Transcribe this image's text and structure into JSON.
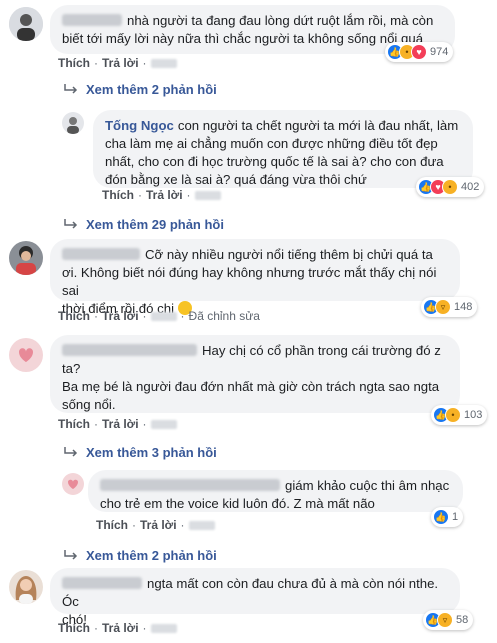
{
  "labels": {
    "like": "Thích",
    "reply": "Trả lời",
    "edited": "Đã chỉnh sửa",
    "sep": "·"
  },
  "colors": {
    "link": "#385898",
    "bubble": "#f2f3f5",
    "like": "#1877f2",
    "love": "#f33e58",
    "sad": "#f7b125"
  },
  "c1": {
    "line1": "nhà người ta đang đau lòng dứt ruột lắm rồi, mà còn",
    "line2": "biết tới mấy lời này nữa thì chắc người ta không sống nổi quá",
    "count": "974",
    "reactions": [
      "like-icon",
      "sad-icon",
      "love-icon"
    ]
  },
  "more1": "Xem thêm 2 phản hồi",
  "r1": {
    "author": "Tống Ngọc",
    "line1": "con người ta chết người ta mới là đau nhất, làm",
    "line2": "cha làm mẹ ai chẳng muốn con được những điều tốt đẹp",
    "line3": "nhất, cho con đi học trường quốc tế là sai à? cho con đưa",
    "line4": "đón bằng xe là sai à? quá đáng vừa thôi chứ",
    "count": "402",
    "reactions": [
      "like-icon",
      "love-icon",
      "sad-icon"
    ]
  },
  "more2": "Xem thêm 29 phản hồi",
  "c2": {
    "line1": "Cỡ này nhiều người nổi tiếng thêm bị chửi quá ta",
    "line2": "ơi. Không biết nói đúng hay không nhưng trước mắt thấy chị nói sai",
    "line3": "thời điểm rồi đó chị",
    "count": "148",
    "reactions": [
      "like-icon",
      "haha-icon"
    ]
  },
  "c3": {
    "line1": "Hay chị có cổ phần trong cái trường đó z",
    "line1b": "ta?",
    "line2": "Ba mẹ bé là người đau đớn nhất mà giờ còn trách ngta sao ngta",
    "line3": "sống nổi.",
    "count": "103",
    "reactions": [
      "like-icon",
      "sad-icon"
    ]
  },
  "more3": "Xem thêm 3 phản hồi",
  "r2": {
    "line1": "giám khảo cuộc thi âm nhạc",
    "line2": "cho trẻ em the voice kid luôn đó. Z mà mất não",
    "count": "1",
    "reactions": [
      "like-icon"
    ]
  },
  "more4": "Xem thêm 2 phản hồi",
  "c4": {
    "line1": "ngta mất con còn đau chưa đủ à mà còn nói nthe. Óc",
    "line2": "chó!",
    "count": "58",
    "reactions": [
      "like-icon",
      "haha-icon"
    ]
  }
}
